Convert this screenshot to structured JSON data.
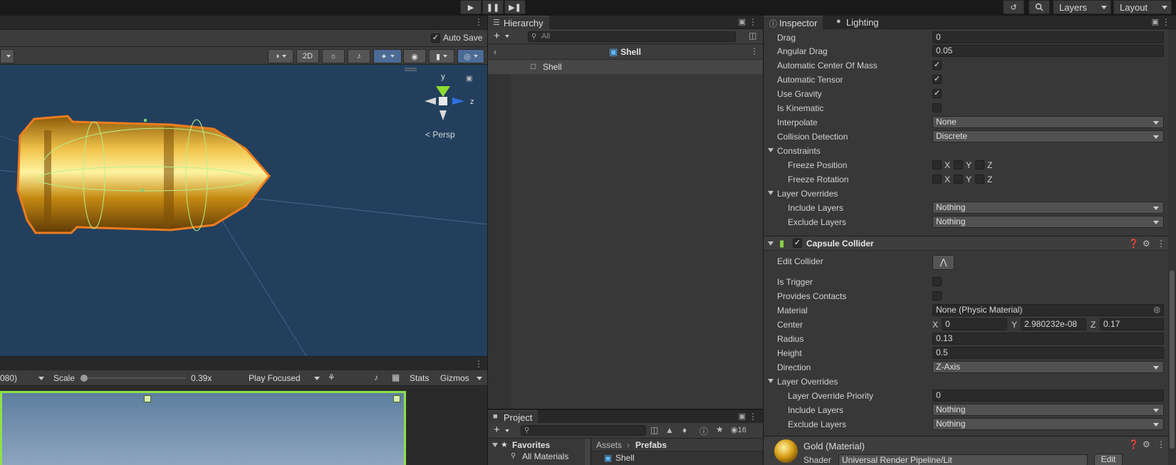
{
  "top_toolbar": {
    "play_icon": "play-icon",
    "pause_icon": "pause-icon",
    "step_icon": "step-icon",
    "layers_label": "Layers",
    "layout_label": "Layout"
  },
  "scene": {
    "auto_save_label": "Auto Save",
    "auto_save_checked": true,
    "btn_2d": "2D",
    "persp_label": "Persp",
    "gizmo_y": "y",
    "gizmo_z": "z",
    "colors": {
      "sky": "#22405e",
      "outline": "#f07c1e",
      "gold": "#d9a516"
    }
  },
  "game": {
    "resolution": "080)",
    "scale_label": "Scale",
    "scale_value": "0.39x",
    "play_mode": "Play Focused",
    "stats_label": "Stats",
    "gizmos_label": "Gizmos"
  },
  "hierarchy": {
    "tab_label": "Hierarchy",
    "search_placeholder": "All",
    "scene_name": "Shell",
    "items": [
      {
        "label": "Shell"
      }
    ]
  },
  "project": {
    "tab_label": "Project",
    "count_badge": "16",
    "favorites_label": "Favorites",
    "favorites_items": [
      "All Materials"
    ],
    "breadcrumb": [
      "Assets",
      "Prefabs"
    ],
    "assets": [
      "Shell"
    ]
  },
  "inspector": {
    "tabs": [
      "Inspector",
      "Lighting"
    ],
    "rigidbody": {
      "drag_label": "Drag",
      "drag": "0",
      "angular_drag_label": "Angular Drag",
      "angular_drag": "0.05",
      "auto_com_label": "Automatic Center Of Mass",
      "auto_tensor_label": "Automatic Tensor",
      "use_gravity_label": "Use Gravity",
      "is_kinematic_label": "Is Kinematic",
      "interpolate_label": "Interpolate",
      "interpolate": "None",
      "collision_label": "Collision Detection",
      "collision": "Discrete",
      "constraints_label": "Constraints",
      "freeze_pos_label": "Freeze Position",
      "freeze_rot_label": "Freeze Rotation",
      "axes": [
        "X",
        "Y",
        "Z"
      ],
      "layer_overrides_label": "Layer Overrides",
      "include_label": "Include Layers",
      "include": "Nothing",
      "exclude_label": "Exclude Layers",
      "exclude": "Nothing"
    },
    "capsule": {
      "title": "Capsule Collider",
      "edit_label": "Edit Collider",
      "is_trigger_label": "Is Trigger",
      "provides_contacts_label": "Provides Contacts",
      "material_label": "Material",
      "material": "None (Physic Material)",
      "center_label": "Center",
      "center_x": "0",
      "center_y": "2.980232e-08",
      "center_z": "0.17",
      "radius_label": "Radius",
      "radius": "0.13",
      "height_label": "Height",
      "height": "0.5",
      "direction_label": "Direction",
      "direction": "Z-Axis",
      "layer_overrides_label": "Layer Overrides",
      "priority_label": "Layer Override Priority",
      "priority": "0",
      "include_label": "Include Layers",
      "include": "Nothing",
      "exclude_label": "Exclude Layers",
      "exclude": "Nothing"
    },
    "material": {
      "name": "Gold (Material)",
      "shader_label": "Shader",
      "shader": "Universal Render Pipeline/Lit",
      "edit_label": "Edit"
    }
  }
}
